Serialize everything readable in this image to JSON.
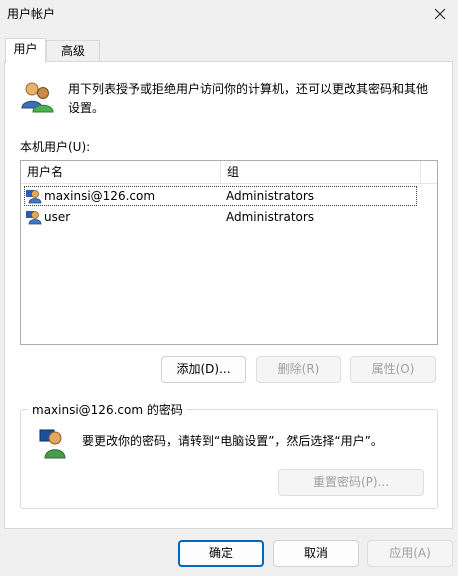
{
  "window": {
    "title": "用户帐户",
    "close_icon": "close-icon"
  },
  "tabs": [
    {
      "label": "用户",
      "active": true
    },
    {
      "label": "高级",
      "active": false
    }
  ],
  "intro": {
    "icon": "users-icon",
    "text": "用下列表授予或拒绝用户访问你的计算机，还可以更改其密码和其他设置。"
  },
  "user_list": {
    "label": "本机用户(U):",
    "columns": [
      "用户名",
      "组"
    ],
    "rows": [
      {
        "name": "maxinsi@126.com",
        "group": "Administrators",
        "icon": "user-icon",
        "selected": true
      },
      {
        "name": "user",
        "group": "Administrators",
        "icon": "user-icon",
        "selected": false
      }
    ]
  },
  "list_buttons": {
    "add": "添加(D)...",
    "remove": "删除(R)",
    "properties": "属性(O)"
  },
  "password_group": {
    "legend": "maxinsi@126.com 的密码",
    "icon": "user-key-icon",
    "text": "要更改你的密码，请转到“电脑设置”，然后选择“用户”。",
    "reset_button": "重置密码(P)..."
  },
  "dialog_buttons": {
    "ok": "确定",
    "cancel": "取消",
    "apply": "应用(A)"
  }
}
